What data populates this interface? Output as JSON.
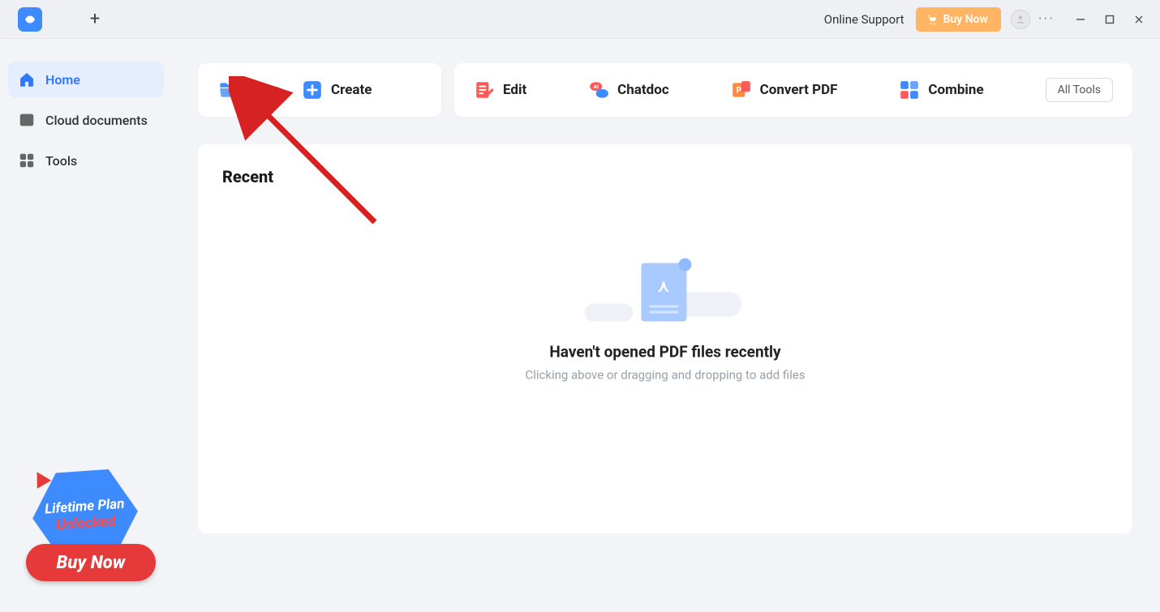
{
  "titlebar": {
    "online_support": "Online Support",
    "buy_now": "Buy Now"
  },
  "sidebar": {
    "items": [
      {
        "label": "Home"
      },
      {
        "label": "Cloud documents"
      },
      {
        "label": "Tools"
      }
    ]
  },
  "promo": {
    "line1": "Lifetime Plan",
    "line2": "Unlocked",
    "cta": "Buy Now"
  },
  "actions": {
    "open": "Open",
    "create": "Create",
    "edit": "Edit",
    "chatdoc": "Chatdoc",
    "convert": "Convert PDF",
    "combine": "Combine",
    "all_tools": "All Tools"
  },
  "recent": {
    "title": "Recent",
    "empty_heading": "Haven't opened PDF files recently",
    "empty_sub": "Clicking above or dragging and dropping to add files"
  },
  "annotation": {
    "target": "open-button"
  }
}
